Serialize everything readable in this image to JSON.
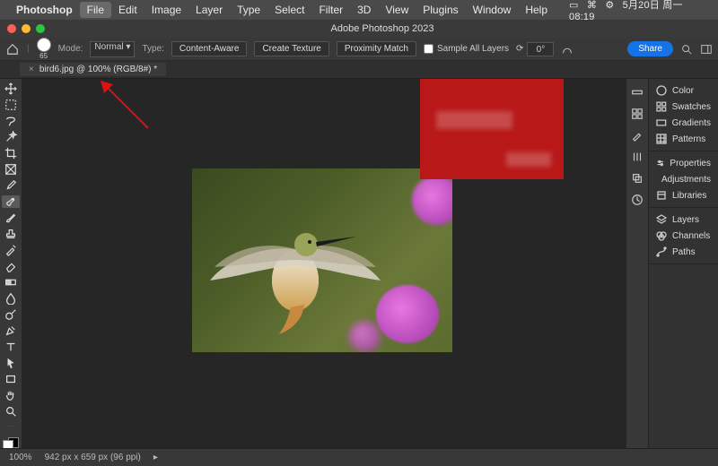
{
  "menubar": {
    "app": "Photoshop",
    "items_left": [
      "File",
      "Edit",
      "Image",
      "Layer",
      "Type",
      "Select",
      "Filter",
      "3D"
    ],
    "items_right": [
      "View",
      "Plugins",
      "Window",
      "Help"
    ],
    "highlighted": "File",
    "sys_date": "5月20日 周一",
    "sys_time": "08:19"
  },
  "window": {
    "title": "Adobe Photoshop 2023"
  },
  "optbar": {
    "brush_size": "65",
    "mode_label": "Mode:",
    "mode_value": "Normal",
    "type_label": "Type:",
    "btn_content_aware": "Content-Aware",
    "btn_create_texture": "Create Texture",
    "btn_proximity": "Proximity Match",
    "chk_sample_all": "Sample All Layers",
    "angle_icon": "⟳",
    "angle_value": "0°",
    "share": "Share"
  },
  "doctab": {
    "label": "bird6.jpg @ 100% (RGB/8#) *"
  },
  "panels": {
    "g1": [
      "Color",
      "Swatches",
      "Gradients",
      "Patterns"
    ],
    "g2": [
      "Properties",
      "Adjustments",
      "Libraries"
    ],
    "g3": [
      "Layers",
      "Channels",
      "Paths"
    ]
  },
  "status": {
    "zoom": "100%",
    "dims": "942 px x 659 px (96 ppi)"
  },
  "tools": [
    "move",
    "marquee",
    "lasso",
    "wand",
    "crop",
    "frame",
    "eyedrop",
    "heal",
    "brush",
    "stamp",
    "history",
    "eraser",
    "gradient",
    "blur",
    "dodge",
    "pen",
    "type",
    "path",
    "rect",
    "hand",
    "zoom"
  ],
  "mini": [
    "ruler",
    "note",
    "count",
    "brushset",
    "clone",
    "histogram"
  ]
}
